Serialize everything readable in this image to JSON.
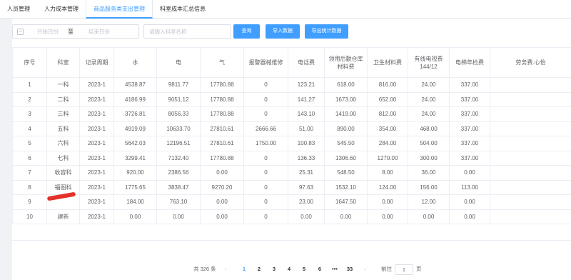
{
  "tabs": [
    {
      "label": "人员管理",
      "active": false
    },
    {
      "label": "人力成本管理",
      "active": false
    },
    {
      "label": "商品服务类支出管理",
      "active": true
    },
    {
      "label": "科室成本汇总信息",
      "active": false
    }
  ],
  "toolbar": {
    "start_placeholder": "开始日份",
    "range_separator": "至",
    "end_placeholder": "结束日份",
    "search_placeholder": "请输入科室名称",
    "query_label": "查询",
    "import_label": "导入数据",
    "export_label": "导出统计数据"
  },
  "table": {
    "columns": [
      "序号",
      "科室",
      "记录周期",
      "水",
      "电",
      "气",
      "报警器械维修",
      "电话费",
      "领用后勤仓库材料费",
      "卫生材料费",
      "有线电视费144/12",
      "电梯年检费",
      "劳务费.心怡"
    ],
    "rows": [
      [
        "1",
        "一科",
        "2023-1",
        "4538.87",
        "9811.77",
        "17780.88",
        "0",
        "123.21",
        "618.00",
        "816.00",
        "24.00",
        "337.00",
        ""
      ],
      [
        "2",
        "二科",
        "2023-1",
        "4186.99",
        "9051.12",
        "17780.88",
        "0",
        "141.27",
        "1673.00",
        "652.00",
        "24.00",
        "337.00",
        ""
      ],
      [
        "3",
        "三科",
        "2023-1",
        "3726.81",
        "8056.33",
        "17780.88",
        "0",
        "143.10",
        "1419.00",
        "812.00",
        "24.00",
        "337.00",
        ""
      ],
      [
        "4",
        "五科",
        "2023-1",
        "4919.09",
        "10633.70",
        "27810.61",
        "2666.66",
        "51.00",
        "890.00",
        "354.00",
        "468.00",
        "337.00",
        ""
      ],
      [
        "5",
        "六科",
        "2023-1",
        "5642.03",
        "12196.51",
        "27810.61",
        "1750.00",
        "100.83",
        "545.50",
        "284.00",
        "504.00",
        "337.00",
        ""
      ],
      [
        "6",
        "七科",
        "2023-1",
        "3299.41",
        "7132.40",
        "17780.88",
        "0",
        "136.33",
        "1306.60",
        "1270.00",
        "300.00",
        "337.00",
        ""
      ],
      [
        "7",
        "收容科",
        "2023-1",
        "920.00",
        "2386.56",
        "0.00",
        "0",
        "25.31",
        "548.50",
        "8.00",
        "36.00",
        "0.00",
        ""
      ],
      [
        "8",
        "福图科",
        "2023-1",
        "1775.65",
        "3838.47",
        "9270.20",
        "0",
        "97.63",
        "1532.10",
        "124.00",
        "156.00",
        "113.00",
        ""
      ],
      [
        "9",
        "",
        "2023-1",
        "184.00",
        "763.10",
        "0.00",
        "0",
        "23.00",
        "1647.50",
        "0.00",
        "12.00",
        "0.00",
        ""
      ],
      [
        "10",
        "建新",
        "2023-1",
        "0.00",
        "0.00",
        "0.00",
        "0",
        "0.00",
        "0.00",
        "0.00",
        "0.00",
        "0.00",
        ""
      ]
    ]
  },
  "pager": {
    "total_label": "共 326 条",
    "pages": [
      "1",
      "2",
      "3",
      "4",
      "5",
      "6",
      "•••",
      "33"
    ],
    "current": "1",
    "goto_label": "前往",
    "goto_value": "1",
    "page_unit": "页",
    "prev_icon": "‹",
    "next_icon": "›"
  },
  "colors": {
    "accent": "#409eff",
    "redaction": "#e4312b"
  }
}
